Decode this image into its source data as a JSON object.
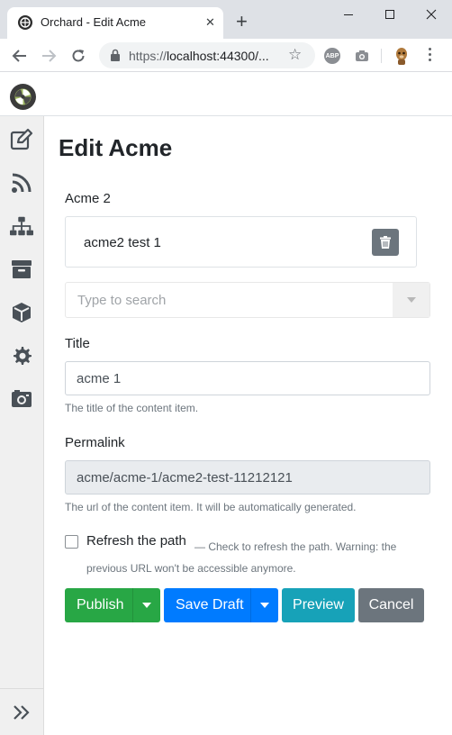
{
  "browser": {
    "tab_title": "Orchard - Edit Acme",
    "tab_close": "✕",
    "new_tab": "+",
    "url_scheme": "https://",
    "url_rest": "localhost:44300/...",
    "abp_label": "ABP"
  },
  "app": {
    "page_title": "Edit Acme",
    "content_picker": {
      "label": "Acme 2",
      "selected_item": "acme2 test 1",
      "search_placeholder": "Type to search"
    },
    "title_field": {
      "label": "Title",
      "value": "acme 1",
      "hint": "The title of the content item."
    },
    "permalink_field": {
      "label": "Permalink",
      "value": "acme/acme-1/acme2-test-11212121",
      "hint": "The url of the content item. It will be automatically generated."
    },
    "refresh": {
      "label": "Refresh the path",
      "note": "— Check to refresh the path. Warning: the previous URL won't be accessible anymore."
    },
    "actions": {
      "publish": "Publish",
      "save_draft": "Save Draft",
      "preview": "Preview",
      "cancel": "Cancel"
    },
    "sidebar_icons": [
      "edit-icon",
      "rss-icon",
      "sitemap-icon",
      "archive-icon",
      "cube-icon",
      "gear-icon",
      "media-icon",
      "expand-icon"
    ],
    "colors": {
      "publish": "#28a745",
      "save_draft": "#007bff",
      "preview": "#17a2b8",
      "cancel": "#6c757d"
    }
  }
}
